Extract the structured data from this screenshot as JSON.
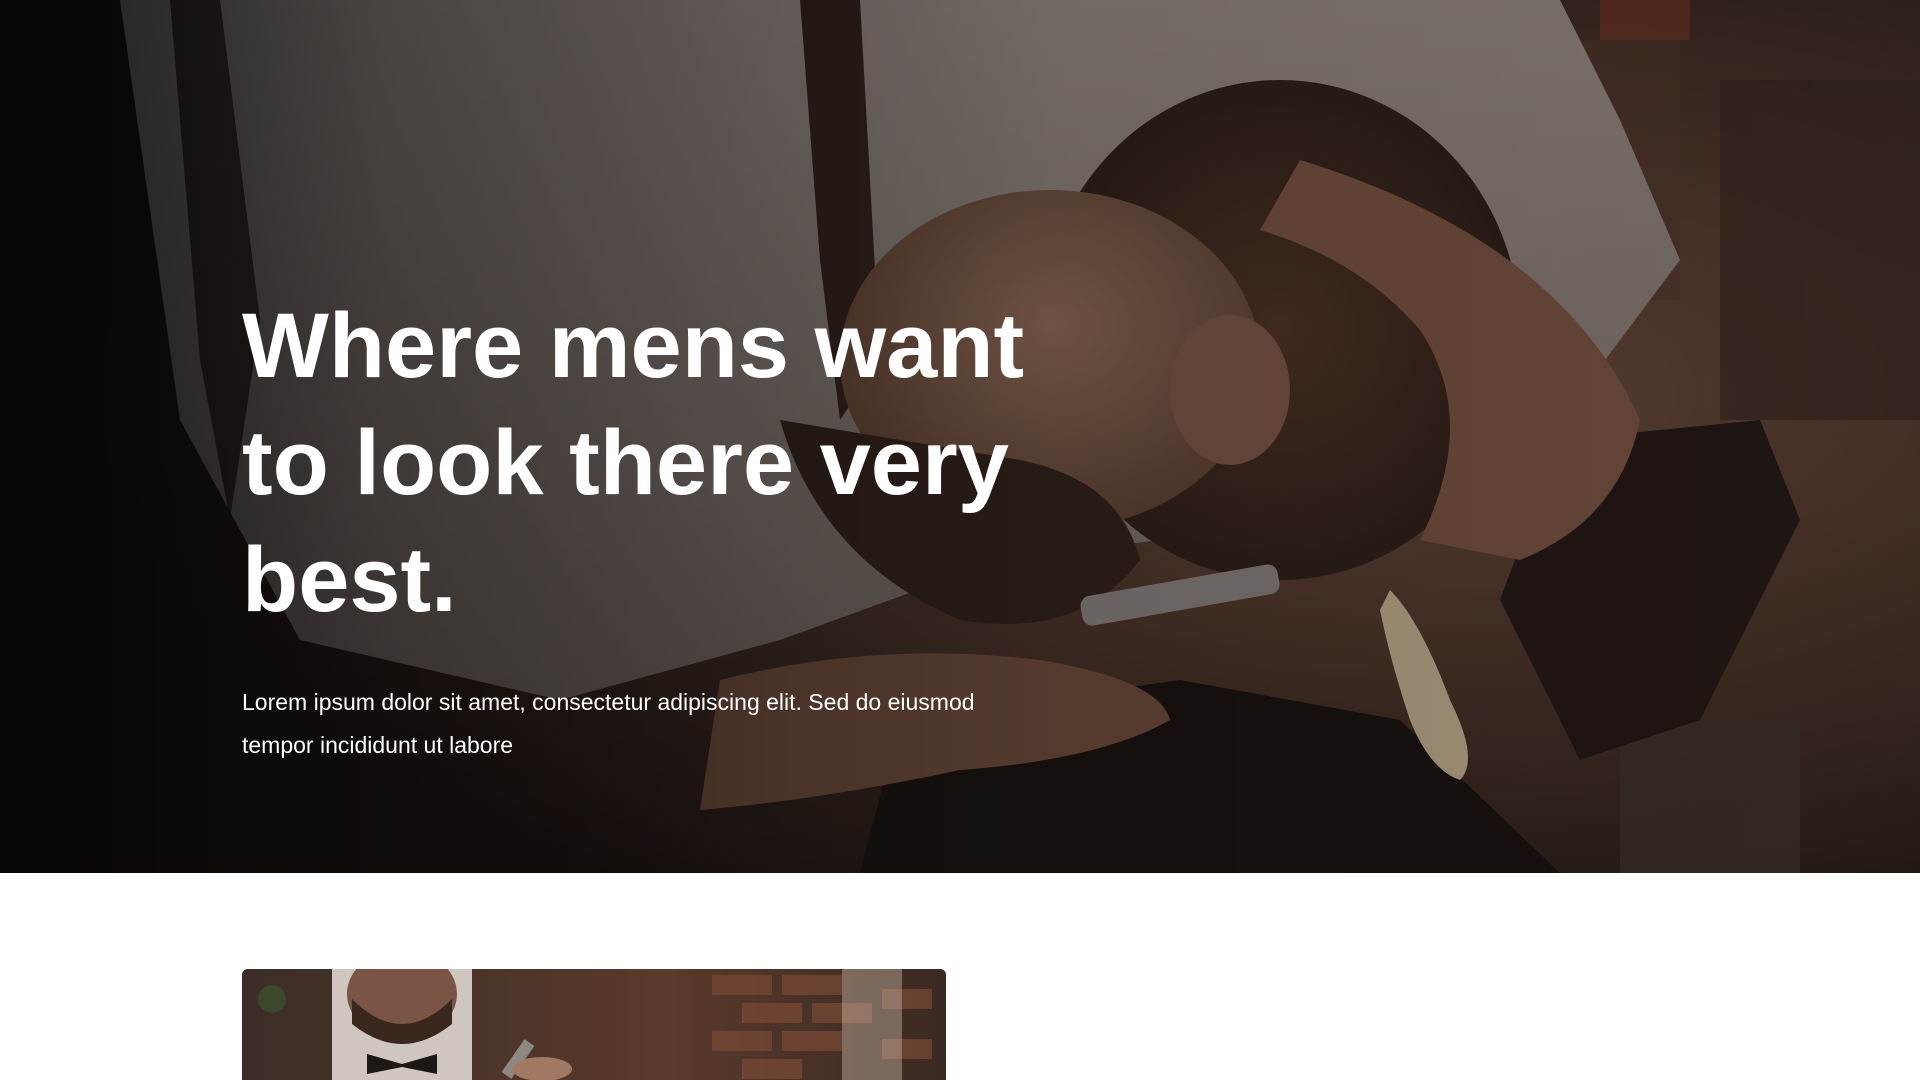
{
  "hero": {
    "heading": "Where mens want to look there very best.",
    "text": "Lorem ipsum dolor sit amet, consectetur adipiscing elit. Sed do eiusmod tempor incididunt ut labore",
    "image": "barber-shaving-beard-photo"
  },
  "about": {
    "image": "barber-holding-scissors-photo"
  },
  "colors": {
    "hero_text": "#ffffff",
    "page_background": "#ffffff",
    "photo_warm_tone": "#6b4a38"
  }
}
